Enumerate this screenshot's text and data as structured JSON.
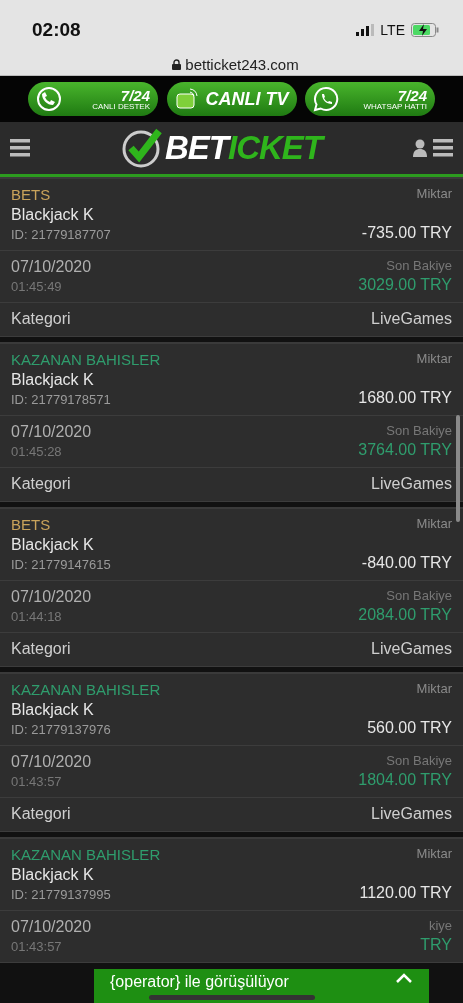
{
  "status_bar": {
    "time": "02:08",
    "network": "LTE"
  },
  "browser": {
    "url": "betticket243.com"
  },
  "promos": [
    {
      "kind": "support",
      "top": "7/24",
      "bottom": "CANLI DESTEK"
    },
    {
      "kind": "tv",
      "top": "CANLI TV"
    },
    {
      "kind": "whatsapp",
      "top": "7/24",
      "bottom": "WHATSAP HATTI"
    }
  ],
  "header": {
    "logo_left": "BET",
    "logo_right": "ICKET"
  },
  "transactions": [
    {
      "kind": "bet",
      "type": "BETS",
      "amount_label": "Miktar",
      "game": "Blackjack K",
      "id": "ID: 21779187707",
      "amount": "-735.00 TRY",
      "date": "07/10/2020",
      "time": "01:45:49",
      "balance_label": "Son Bakiye",
      "balance": "3029.00 TRY",
      "category_label": "Kategori",
      "category": "LiveGames"
    },
    {
      "kind": "win",
      "type": "KAZANAN BAHISLER",
      "amount_label": "Miktar",
      "game": "Blackjack K",
      "id": "ID: 21779178571",
      "amount": "1680.00 TRY",
      "date": "07/10/2020",
      "time": "01:45:28",
      "balance_label": "Son Bakiye",
      "balance": "3764.00 TRY",
      "category_label": "Kategori",
      "category": "LiveGames"
    },
    {
      "kind": "bet",
      "type": "BETS",
      "amount_label": "Miktar",
      "game": "Blackjack K",
      "id": "ID: 21779147615",
      "amount": "-840.00 TRY",
      "date": "07/10/2020",
      "time": "01:44:18",
      "balance_label": "Son Bakiye",
      "balance": "2084.00 TRY",
      "category_label": "Kategori",
      "category": "LiveGames"
    },
    {
      "kind": "win",
      "type": "KAZANAN BAHISLER",
      "amount_label": "Miktar",
      "game": "Blackjack K",
      "id": "ID: 21779137976",
      "amount": "560.00 TRY",
      "date": "07/10/2020",
      "time": "01:43:57",
      "balance_label": "Son Bakiye",
      "balance": "1804.00 TRY",
      "category_label": "Kategori",
      "category": "LiveGames"
    },
    {
      "kind": "win",
      "type": "KAZANAN BAHISLER",
      "amount_label": "Miktar",
      "game": "Blackjack K",
      "id": "ID: 21779137995",
      "amount": "1120.00 TRY",
      "date": "07/10/2020",
      "time": "01:43:57",
      "balance_label": "kiye",
      "balance": "TRY"
    }
  ],
  "chat_bar": {
    "text": "{operator} ile görüşülüyor"
  }
}
